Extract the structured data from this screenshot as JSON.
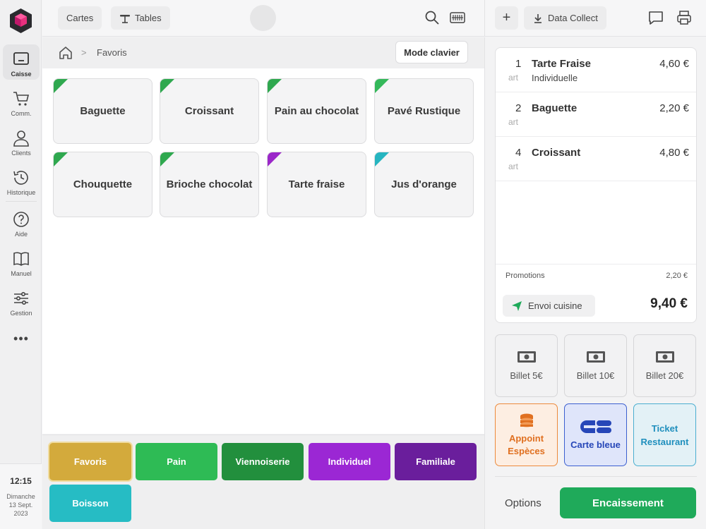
{
  "nav": {
    "items": [
      {
        "label": "Caisse",
        "icon": "register-icon"
      },
      {
        "label": "Comm.",
        "icon": "cart-icon"
      },
      {
        "label": "Clients",
        "icon": "user-icon"
      },
      {
        "label": "Historique",
        "icon": "history-icon"
      },
      {
        "label": "Aide",
        "icon": "help-icon"
      },
      {
        "label": "Manuel",
        "icon": "book-icon"
      },
      {
        "label": "Gestion",
        "icon": "sliders-icon"
      }
    ],
    "more": "•••",
    "time": "12:15",
    "date_line1": "Dimanche",
    "date_line2": "13 Sept.",
    "date_line3": "2023"
  },
  "topbar": {
    "cartes_label": "Cartes",
    "tables_label": "Tables",
    "add_label": "+",
    "data_collect_label": "Data Collect"
  },
  "breadcrumb": {
    "separator": ">",
    "current": "Favoris",
    "mode_clavier": "Mode clavier"
  },
  "products": [
    {
      "name": "Baguette",
      "color": "#2fa84f"
    },
    {
      "name": "Croissant",
      "color": "#2fa84f"
    },
    {
      "name": "Pain au chocolat",
      "color": "#2fa84f"
    },
    {
      "name": "Pavé Rustique",
      "color": "#34b85a"
    },
    {
      "name": "Chouquette",
      "color": "#2fa84f"
    },
    {
      "name": "Brioche chocolat",
      "color": "#2fa84f"
    },
    {
      "name": "Tarte fraise",
      "color": "#9b27c9"
    },
    {
      "name": "Jus d'orange",
      "color": "#26b5c0"
    }
  ],
  "categories": [
    {
      "label": "Favoris",
      "color": "#d3aa3c"
    },
    {
      "label": "Pain",
      "color": "#2ebb55"
    },
    {
      "label": "Viennoiserie",
      "color": "#228f3d"
    },
    {
      "label": "Individuel",
      "color": "#9b27d4"
    },
    {
      "label": "Familiale",
      "color": "#6a1e9c"
    },
    {
      "label": "Boisson",
      "color": "#26bcc4"
    }
  ],
  "order": {
    "lines": [
      {
        "qty": "1",
        "unit": "art",
        "name": "Tarte Fraise",
        "sub": "Individuelle",
        "price": "4,60 €"
      },
      {
        "qty": "2",
        "unit": "art",
        "name": "Baguette",
        "sub": "",
        "price": "2,20 €"
      },
      {
        "qty": "4",
        "unit": "art",
        "name": "Croissant",
        "sub": "",
        "price": "4,80 €"
      }
    ],
    "promotions_label": "Promotions",
    "promotions_value": "2,20 €",
    "envoi_label": "Envoi cuisine",
    "total": "9,40 €"
  },
  "payments": {
    "billet5": "Billet 5€",
    "billet10": "Billet 10€",
    "billet20": "Billet 20€",
    "appoint_line1": "Appoint",
    "appoint_line2": "Espèces",
    "carte_bleue": "Carte bleue",
    "ticket_line1": "Ticket",
    "ticket_line2": "Restaurant"
  },
  "footer": {
    "options": "Options",
    "encaissement": "Encaissement"
  },
  "colors": {
    "accent_green": "#1faa5a",
    "cash_orange": "#ec8a3c",
    "card_blue": "#3c5fd0",
    "resto_cyan": "#4aaed0"
  }
}
